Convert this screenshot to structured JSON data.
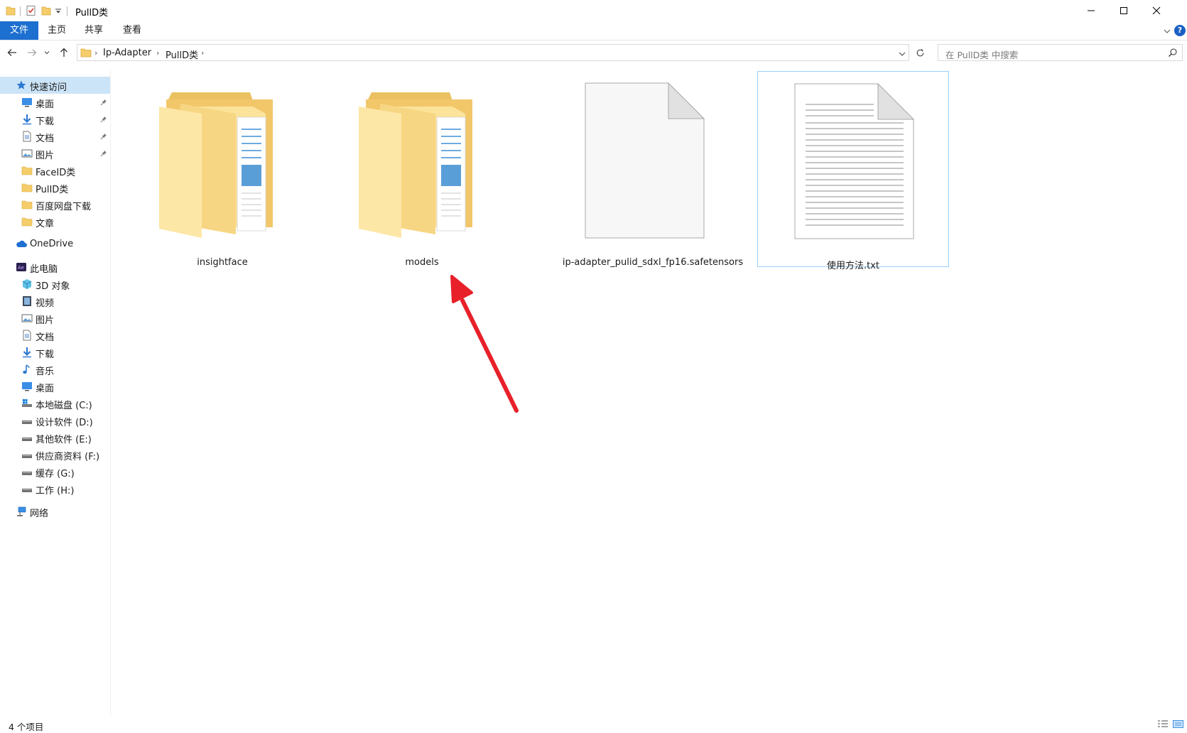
{
  "window": {
    "title": "PullD类"
  },
  "ribbon": {
    "tabs": [
      {
        "label": "文件"
      },
      {
        "label": "主页"
      },
      {
        "label": "共享"
      },
      {
        "label": "查看"
      }
    ]
  },
  "address": {
    "crumbs": [
      "Ip-Adapter",
      "PullD类"
    ],
    "search_placeholder": "在 PullD类 中搜索"
  },
  "sidebar": {
    "quick_access": "快速访问",
    "pinned": [
      {
        "label": "桌面",
        "icon": "desktop-icon"
      },
      {
        "label": "下载",
        "icon": "download-icon"
      },
      {
        "label": "文档",
        "icon": "document-icon"
      },
      {
        "label": "图片",
        "icon": "pictures-icon"
      }
    ],
    "folders": [
      {
        "label": "FaceID类"
      },
      {
        "label": "PulID类"
      },
      {
        "label": "百度网盘下载"
      },
      {
        "label": "文章"
      }
    ],
    "onedrive": "OneDrive",
    "this_pc": "此电脑",
    "pc_items": [
      {
        "label": "3D 对象",
        "icon": "3d-objects-icon"
      },
      {
        "label": "视频",
        "icon": "videos-icon"
      },
      {
        "label": "图片",
        "icon": "pictures-icon"
      },
      {
        "label": "文档",
        "icon": "document-icon"
      },
      {
        "label": "下载",
        "icon": "download-icon"
      },
      {
        "label": "音乐",
        "icon": "music-icon"
      },
      {
        "label": "桌面",
        "icon": "desktop-icon"
      },
      {
        "label": "本地磁盘 (C:)",
        "icon": "system-drive-icon"
      },
      {
        "label": "设计软件 (D:)",
        "icon": "drive-icon"
      },
      {
        "label": "其他软件 (E:)",
        "icon": "drive-icon"
      },
      {
        "label": "供应商资料 (F:)",
        "icon": "drive-icon"
      },
      {
        "label": "缓存 (G:)",
        "icon": "drive-icon"
      },
      {
        "label": "工作 (H:)",
        "icon": "drive-icon"
      }
    ],
    "network": "网络"
  },
  "files": [
    {
      "name": "insightface",
      "type": "folder"
    },
    {
      "name": "models",
      "type": "folder"
    },
    {
      "name": "ip-adapter_pulid_sdxl_fp16.safetensors",
      "type": "file"
    },
    {
      "name": "使用方法.txt",
      "type": "text",
      "selected": true
    }
  ],
  "status": {
    "count": "4 个项目"
  },
  "colors": {
    "accent": "#1d6fd0",
    "selection": "#cce4f7",
    "arrow": "#e8202a"
  }
}
